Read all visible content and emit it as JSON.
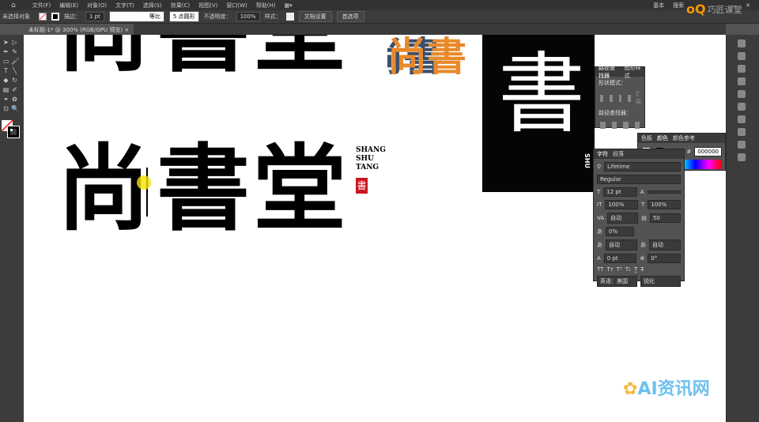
{
  "menu": [
    "文件(F)",
    "编辑(E)",
    "对象(O)",
    "文字(T)",
    "选择(S)",
    "效果(C)",
    "视图(V)",
    "窗口(W)",
    "帮助(H)"
  ],
  "workspace": "基本",
  "search_placeholder": "搜索",
  "control": {
    "selection": "未选择对象",
    "stroke_label": "描边：",
    "stroke_value": "1 pt",
    "stroke_style": "等比",
    "brush": "5 点圆形",
    "opacity_label": "不透明度：",
    "opacity_value": "100%",
    "style_label": "样式：",
    "doc_setup": "文档设置",
    "prefs": "首选项"
  },
  "document_tab": {
    "title": "未标题-1* @ 300% (RGB/GPU 预览)",
    "close": "×"
  },
  "artwork": {
    "chars": [
      "尚",
      "書",
      "堂"
    ],
    "pinyin": [
      "SHANG",
      "SHU",
      "TANG"
    ],
    "seal": "書",
    "dark_char": "書",
    "dark_latin": "SHU",
    "logo_chars": "尚書"
  },
  "pathfinder_panel": {
    "tabs": [
      "路径查找器",
      "图形样式"
    ],
    "shape_modes": "形状模式：",
    "pathfinders": "路径查找器：",
    "expand": "扩展"
  },
  "color_panel": {
    "tabs": [
      "色板",
      "颜色",
      "颜色参考"
    ],
    "hex_label": "#",
    "hex": "000000"
  },
  "character_panel": {
    "tabs": [
      "字符",
      "段落"
    ],
    "font": "Lifetime",
    "style": "Regular",
    "size": "12 pt",
    "leading": "",
    "vscale": "100%",
    "hscale": "100%",
    "kerning": "自动",
    "tracking": "50",
    "shift": "0%",
    "aki_left": "自动",
    "aki_right": "自动",
    "baseline": "0 pt",
    "rotation": "0°",
    "language": "英语：美国",
    "aa": "锐化"
  },
  "watermarks": {
    "top": "巧匠课堂",
    "bottom": "AI资讯网"
  },
  "colors": {
    "accent": "#f39800",
    "seal": "#c8161d"
  }
}
